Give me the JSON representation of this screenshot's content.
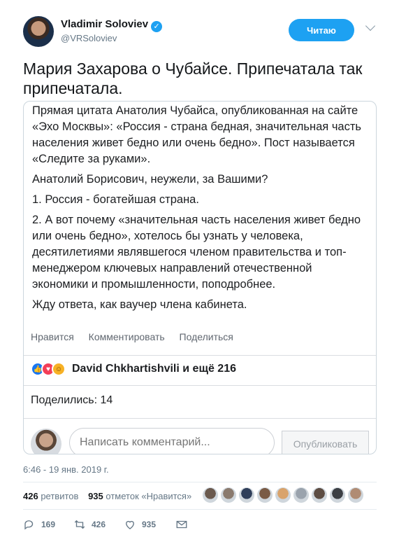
{
  "author": {
    "name": "Vladimir Soloviev",
    "handle": "@VRSoloviev",
    "verified_glyph": "✓",
    "follow_label": "Читаю"
  },
  "tweet": {
    "text": "Мария Захарова о Чубайсе.  Припечатала так припечатала."
  },
  "embed": {
    "paragraphs": [
      "Прямая цитата Анатолия Чубайса, опубликованная на сайте «Эхо Москвы»: «Россия - страна бедная, значительная часть населения живет бедно или очень бедно». Пост называется «Следите за руками».",
      "Анатолий Борисович, неужели, за Вашими?",
      "1. Россия - богатейшая страна.",
      "2. А вот почему «значительная часть населения живет бедно или очень бедно», хотелось бы узнать у человека, десятилетиями являвшегося членом правительства и топ-менеджером ключевых направлений отечественной экономики и промышленности, поподробнее.",
      "Жду ответа, как ваучер члена кабинета."
    ],
    "actions": [
      "Нравится",
      "Комментировать",
      "Поделиться"
    ],
    "reactions_text": "David Chkhartishvili и ещё 216",
    "shares_text": "Поделились: 14",
    "comment_placeholder": "Написать комментарий...",
    "publish_label": "Опубликовать"
  },
  "timestamp": "6:46 - 19 янв. 2019 г.",
  "stats": {
    "retweets_count": "426",
    "retweets_label": "ретвитов",
    "likes_count": "935",
    "likes_label": "отметок «Нравится»"
  },
  "liker_colors": [
    "#6b5a4e",
    "#8a7a6e",
    "#2f3f5a",
    "#7a5b45",
    "#d9a36b",
    "#9aa3ad",
    "#5d4d43",
    "#3c3f44",
    "#b08c74"
  ],
  "action_bar": {
    "replies": "169",
    "retweets": "426",
    "likes": "935"
  },
  "colors": {
    "accent": "#1da1f2",
    "muted": "#657786"
  }
}
